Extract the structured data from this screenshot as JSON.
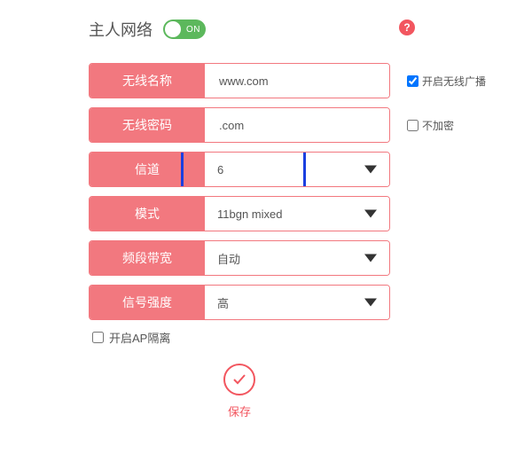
{
  "header": {
    "title": "主人网络",
    "toggle_text": "ON",
    "help": "?"
  },
  "rows": {
    "ssid": {
      "label": "无线名称",
      "value": "www.com"
    },
    "pwd": {
      "label": "无线密码",
      "value": ".com"
    },
    "channel": {
      "label": "信道",
      "value": "6"
    },
    "mode": {
      "label": "模式",
      "value": "11bgn mixed"
    },
    "bw": {
      "label": "频段带宽",
      "value": "自动"
    },
    "signal": {
      "label": "信号强度",
      "value": "高"
    }
  },
  "aux": {
    "broadcast": "开启无线广播",
    "no_encrypt": "不加密",
    "ap_isolation": "开启AP隔离"
  },
  "save": "保存"
}
